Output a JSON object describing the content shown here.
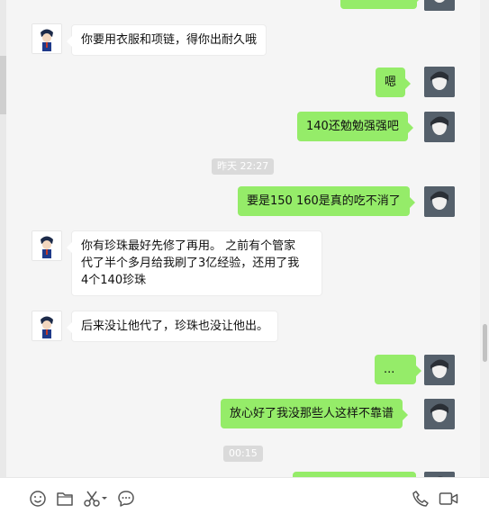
{
  "colors": {
    "self_bubble": "#95ec69",
    "other_bubble": "#ffffff",
    "background": "#f5f5f5",
    "timestamp_bg": "#dadada"
  },
  "messages": [
    {
      "side": "right",
      "text": ""
    },
    {
      "side": "left",
      "text": "你要用衣服和项链，得你出耐久哦"
    },
    {
      "side": "right",
      "text": "嗯"
    },
    {
      "side": "right",
      "text": "140还勉勉强强吧"
    },
    {
      "side": "right",
      "text": "要是150 160是真的吃不消了"
    },
    {
      "side": "left",
      "lines": [
        "你有珍珠最好先修了再用。 之前有个管家",
        "代了半个多月给我刷了3亿经验，还用了我",
        "4个140珍珠"
      ]
    },
    {
      "side": "left",
      "text": "后来没让他代了，珍珠也没让他出。"
    },
    {
      "side": "right",
      "text": "..."
    },
    {
      "side": "right",
      "text": "放心好了我没那些人这样不靠谱"
    },
    {
      "side": "right",
      "text": ""
    }
  ],
  "timestamps": [
    "昨天 22:27",
    "00:15"
  ],
  "toolbar": {
    "left_icons": [
      "emoji-icon",
      "folder-icon",
      "scissors-icon",
      "chat-bubble-icon"
    ],
    "right_icons": [
      "phone-icon",
      "video-icon"
    ]
  }
}
